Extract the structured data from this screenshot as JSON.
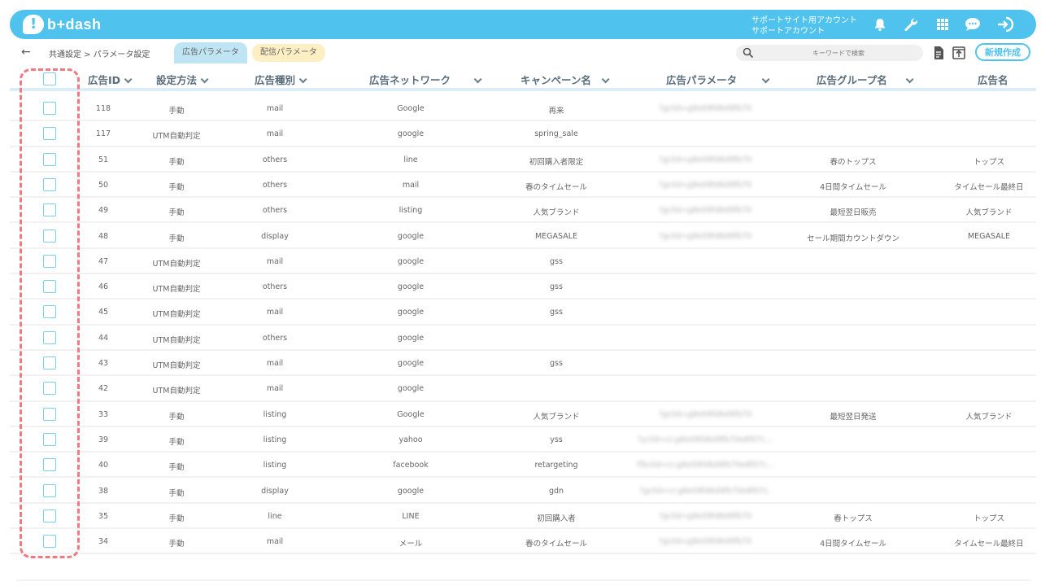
{
  "app": {
    "logo_text": "b+dash"
  },
  "account": {
    "line1": "サポートサイト用アカウント",
    "line2": "サポートアカウント"
  },
  "toolbar_icons": [
    "bell-icon",
    "wrench-icon",
    "grid-icon",
    "chat-icon",
    "logout-icon"
  ],
  "breadcrumb": {
    "text": "共通設定 > パラメータ設定"
  },
  "tabs": [
    {
      "label": "広告パラメータ"
    },
    {
      "label": "配信パラメータ"
    }
  ],
  "search": {
    "placeholder": "キーワードで検索"
  },
  "actions": {
    "new_label": "新規作成"
  },
  "columns": [
    "広告ID",
    "設定方法",
    "広告種別",
    "広告ネットワーク",
    "キャンペーン名",
    "広告パラメータ",
    "広告グループ名",
    "広告名"
  ],
  "rows": [
    {
      "id": "118",
      "method": "手動",
      "type": "mail",
      "network": "Google",
      "campaign": "再来",
      "param": "?gclid=g8e09fd6d9fb70",
      "group": "",
      "ad": ""
    },
    {
      "id": "117",
      "method": "UTM自動判定",
      "type": "mail",
      "network": "google",
      "campaign": "spring_sale",
      "param": "",
      "group": "",
      "ad": ""
    },
    {
      "id": "51",
      "method": "手動",
      "type": "others",
      "network": "line",
      "campaign": "初回購入者限定",
      "param": "?gclid=g8e09fd6d9fb70",
      "group": "春のトップス",
      "ad": "トップス"
    },
    {
      "id": "50",
      "method": "手動",
      "type": "others",
      "network": "mail",
      "campaign": "春のタイムセール",
      "param": "?gclid=g8e09fd6d9fb70",
      "group": "4日間タイムセール",
      "ad": "タイムセール最終日"
    },
    {
      "id": "49",
      "method": "手動",
      "type": "others",
      "network": "listing",
      "campaign": "人気ブランド",
      "param": "?gclid=g8e09fd6d9fb70",
      "group": "最短翌日販売",
      "ad": "人気ブランド"
    },
    {
      "id": "48",
      "method": "手動",
      "type": "display",
      "network": "google",
      "campaign": "MEGASALE",
      "param": "?gclid=g8e09fd6d9fb70",
      "group": "セール期間カウントダウン",
      "ad": "MEGASALE"
    },
    {
      "id": "47",
      "method": "UTM自動判定",
      "type": "mail",
      "network": "google",
      "campaign": "gss",
      "param": "",
      "group": "",
      "ad": ""
    },
    {
      "id": "46",
      "method": "UTM自動判定",
      "type": "others",
      "network": "google",
      "campaign": "gss",
      "param": "",
      "group": "",
      "ad": ""
    },
    {
      "id": "45",
      "method": "UTM自動判定",
      "type": "mail",
      "network": "google",
      "campaign": "gss",
      "param": "",
      "group": "",
      "ad": ""
    },
    {
      "id": "44",
      "method": "UTM自動判定",
      "type": "others",
      "network": "google",
      "campaign": "",
      "param": "",
      "group": "",
      "ad": ""
    },
    {
      "id": "43",
      "method": "UTM自動判定",
      "type": "mail",
      "network": "google",
      "campaign": "gss",
      "param": "",
      "group": "",
      "ad": ""
    },
    {
      "id": "42",
      "method": "UTM自動判定",
      "type": "mail",
      "network": "google",
      "campaign": "",
      "param": "",
      "group": "",
      "ad": ""
    },
    {
      "id": "33",
      "method": "手動",
      "type": "listing",
      "network": "Google",
      "campaign": "人気ブランド",
      "param": "?gclid=g8e09fd6d9fb70",
      "group": "最短翌日発送",
      "ad": "人気ブランド"
    },
    {
      "id": "39",
      "method": "手動",
      "type": "listing",
      "network": "yahoo",
      "campaign": "yss",
      "param": "?yclid=cr.g8e09fd6d9fb70e8f07c...",
      "group": "",
      "ad": ""
    },
    {
      "id": "40",
      "method": "手動",
      "type": "listing",
      "network": "facebook",
      "campaign": "retargeting",
      "param": "?fbclid=cr.g8e09fd6d9fb70e8f07c...",
      "group": "",
      "ad": ""
    },
    {
      "id": "38",
      "method": "手動",
      "type": "display",
      "network": "google",
      "campaign": "gdn",
      "param": "?gclid=cr.g8e09fd6d9fb70e8f07c.",
      "group": "",
      "ad": ""
    },
    {
      "id": "35",
      "method": "手動",
      "type": "line",
      "network": "LINE",
      "campaign": "初回購入者",
      "param": "?gclid=g8e09fd6d9fb70",
      "group": "春トップス",
      "ad": "トップス"
    },
    {
      "id": "34",
      "method": "手動",
      "type": "mail",
      "network": "メール",
      "campaign": "春のタイムセール",
      "param": "?gclid=g8e09fd6d9fb70",
      "group": "4日間タイムセール",
      "ad": "タイムセール最終日"
    }
  ],
  "colors": {
    "brand": "#4fc3ee",
    "highlight": "#ee7a82"
  }
}
